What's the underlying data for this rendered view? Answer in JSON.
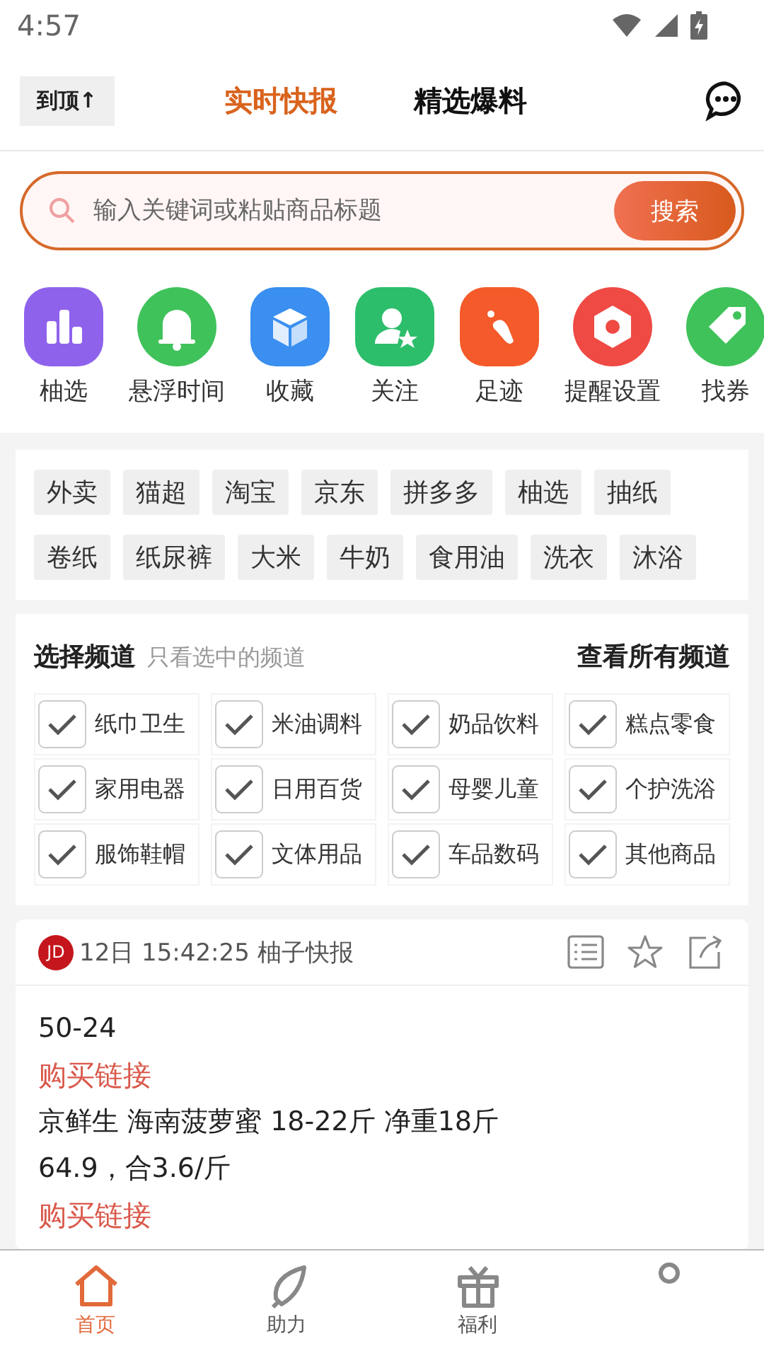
{
  "status_bar": {
    "time": "4:57"
  },
  "header": {
    "top_button": "到顶↑",
    "tabs": [
      {
        "label": "实时快报",
        "selected": true
      },
      {
        "label": "精选爆料",
        "selected": false
      }
    ]
  },
  "search": {
    "placeholder": "输入关键词或粘贴商品标题",
    "button": "搜索"
  },
  "shortcuts": [
    {
      "label": "柚选",
      "color": "#8f62ec"
    },
    {
      "label": "悬浮时间",
      "color": "#3fc25a"
    },
    {
      "label": "收藏",
      "color": "#3a8ff0"
    },
    {
      "label": "关注",
      "color": "#2dbe6c"
    },
    {
      "label": "足迹",
      "color": "#f45a2a"
    },
    {
      "label": "提醒设置",
      "color": "#ef4a43"
    },
    {
      "label": "找券",
      "color": "#3fc25a"
    }
  ],
  "tags": [
    "外卖",
    "猫超",
    "淘宝",
    "京东",
    "拼多多",
    "柚选",
    "抽纸",
    "卷纸",
    "纸尿裤",
    "大米",
    "牛奶",
    "食用油",
    "洗衣",
    "沐浴"
  ],
  "channels": {
    "title": "选择频道",
    "hint": "只看选中的频道",
    "all_link": "查看所有频道",
    "items": [
      {
        "label": "纸巾卫生",
        "checked": true
      },
      {
        "label": "米油调料",
        "checked": true
      },
      {
        "label": "奶品饮料",
        "checked": true
      },
      {
        "label": "糕点零食",
        "checked": true
      },
      {
        "label": "家用电器",
        "checked": true
      },
      {
        "label": "日用百货",
        "checked": true
      },
      {
        "label": "母婴儿童",
        "checked": true
      },
      {
        "label": "个护洗浴",
        "checked": true
      },
      {
        "label": "服饰鞋帽",
        "checked": true
      },
      {
        "label": "文体用品",
        "checked": true
      },
      {
        "label": "车品数码",
        "checked": true
      },
      {
        "label": "其他商品",
        "checked": true
      }
    ]
  },
  "post": {
    "badge": "JD",
    "meta": "12日 15:42:25 柚子快报",
    "lines": [
      {
        "kind": "text",
        "text": "50-24"
      },
      {
        "kind": "link",
        "text": "购买链接"
      },
      {
        "kind": "text",
        "text": "京鲜生 海南菠萝蜜 18-22斤 净重18斤"
      },
      {
        "kind": "text",
        "text": "64.9，合3.6/斤"
      },
      {
        "kind": "link",
        "text": "购买链接"
      }
    ]
  },
  "bottom_nav": [
    {
      "label": "首页",
      "selected": true
    },
    {
      "label": "助力",
      "selected": false
    },
    {
      "label": "福利",
      "selected": false
    },
    {
      "selected": false
    }
  ]
}
